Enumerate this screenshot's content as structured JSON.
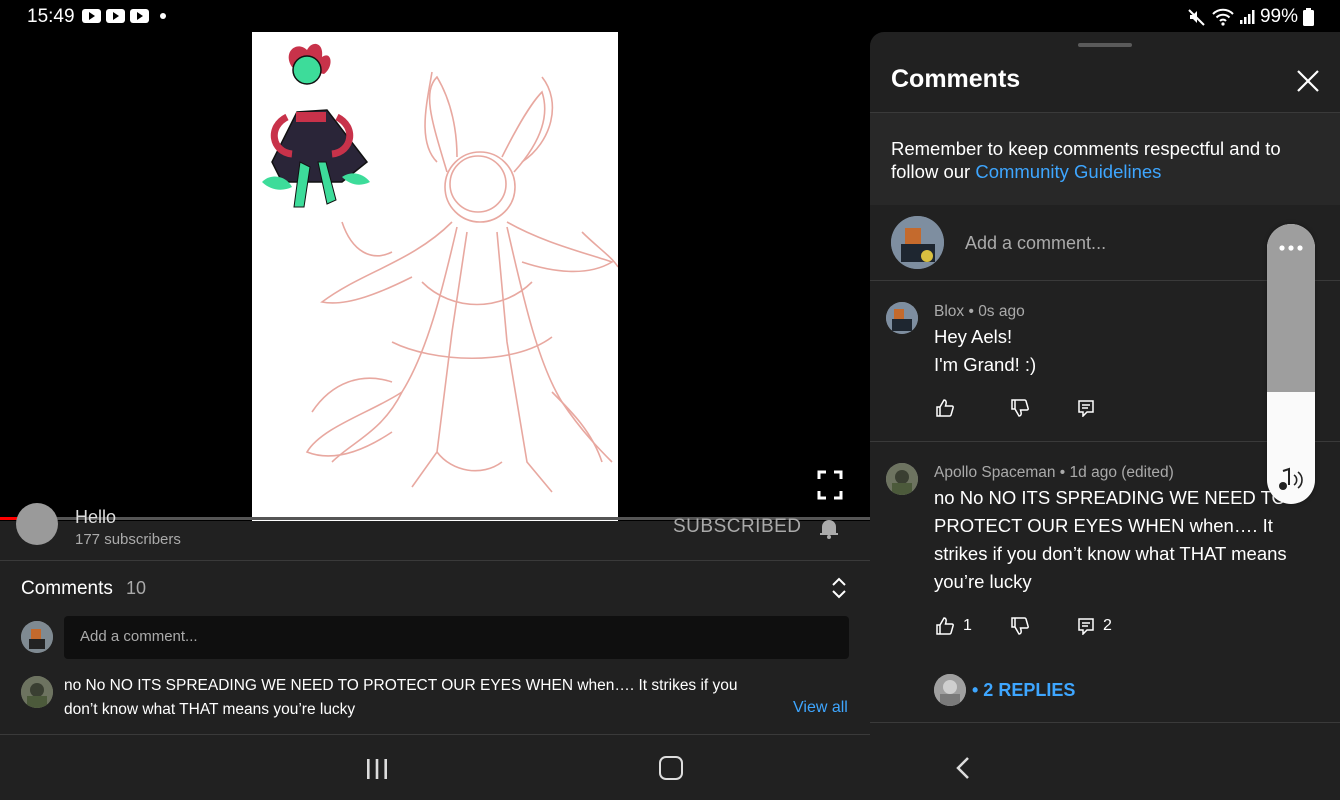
{
  "status_bar": {
    "time": "15:49",
    "battery": "99%",
    "icons": [
      "youtube-notification-icon",
      "youtube-notification-icon",
      "youtube-notification-icon",
      "mute-icon",
      "wifi-icon",
      "signal-icon",
      "battery-icon"
    ]
  },
  "player": {
    "progress": 0.05,
    "accent": "#ff0000"
  },
  "channel": {
    "name": "Hello",
    "subscribers": "177 subscribers",
    "subscribe_label": "SUBSCRIBED"
  },
  "comments_section": {
    "title": "Comments",
    "count": "10",
    "add_placeholder": "Add a comment...",
    "top_comment": "no No NO ITS SPREADING WE NEED TO PROTECT OUR EYES WHEN when…. It strikes if you don’t know what THAT means you’re lucky",
    "view_all": "View all"
  },
  "panel": {
    "title": "Comments",
    "guidelines_prefix": "Remember to keep comments respectful and to follow our ",
    "guidelines_link": "Community Guidelines",
    "add_placeholder": "Add a comment...",
    "comments": [
      {
        "author_meta": "Blox • 0s ago",
        "line1": "Hey Aels!",
        "line2": "I'm Grand! :)",
        "likes": "",
        "replies": ""
      },
      {
        "author_meta": "Apollo Spaceman • 1d ago (edited)",
        "text": "no No NO ITS SPREADING WE NEED TO PROTECT OUR EYES WHEN when…. It strikes if you don’t know what THAT means you’re lucky",
        "likes": "1",
        "replies": "2",
        "replies_link": "• 2 REPLIES"
      }
    ]
  },
  "volume": {
    "level": 0.4
  },
  "colors": {
    "link": "#3ea6ff",
    "surface": "#212121",
    "background": "#000000"
  }
}
